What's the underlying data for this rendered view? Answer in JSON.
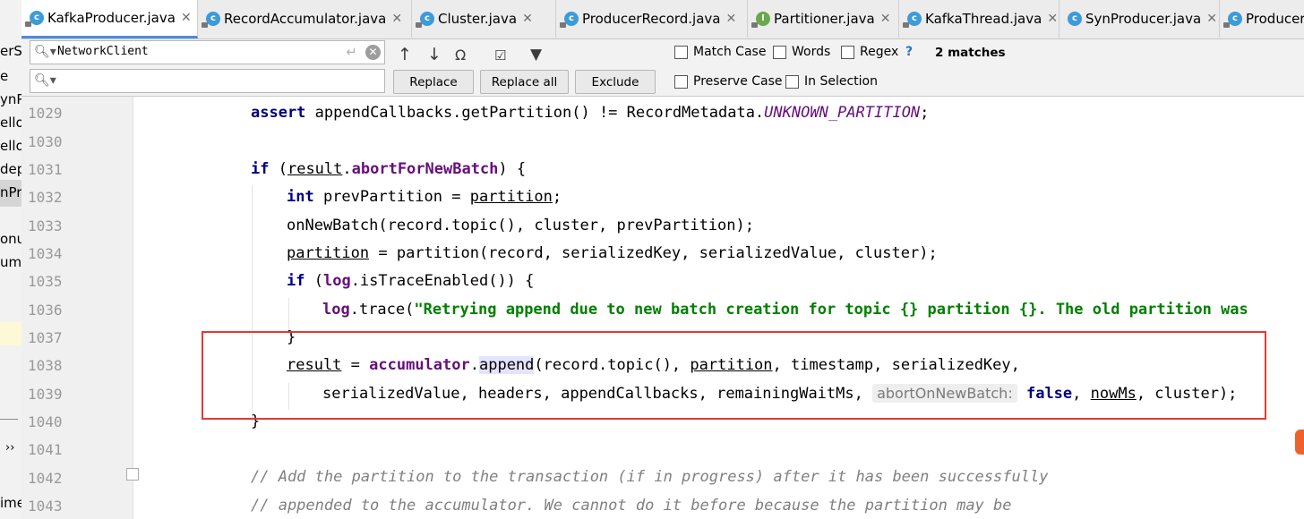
{
  "left_panel": {
    "fragments": [
      "erS",
      "e",
      "ynP",
      "ello",
      "ello",
      "dep",
      "nPr",
      "onus",
      "ume",
      "ime",
      "››"
    ]
  },
  "tabs": [
    {
      "label": "KafkaProducer.java",
      "icon": "class-icon",
      "active": true
    },
    {
      "label": "RecordAccumulator.java",
      "icon": "class-icon"
    },
    {
      "label": "Cluster.java",
      "icon": "class-icon"
    },
    {
      "label": "ProducerRecord.java",
      "icon": "class-icon"
    },
    {
      "label": "Partitioner.java",
      "icon": "interface-icon"
    },
    {
      "label": "KafkaThread.java",
      "icon": "class-icon"
    },
    {
      "label": "SynProducer.java",
      "icon": "class-icon"
    },
    {
      "label": "ProducerC",
      "icon": "class-icon"
    }
  ],
  "find": {
    "search_value": "NetworkClient",
    "replace_value": "",
    "buttons": {
      "replace": "Replace",
      "replace_all": "Replace all",
      "exclude": "Exclude"
    },
    "options": {
      "match_case": "Match Case",
      "words": "Words",
      "regex": "Regex",
      "preserve_case": "Preserve Case",
      "in_selection": "In Selection"
    },
    "help": "?",
    "matches": "2 matches"
  },
  "editor": {
    "line_numbers": [
      "1029",
      "1030",
      "1031",
      "1032",
      "1033",
      "1034",
      "1035",
      "1036",
      "1037",
      "1038",
      "1039",
      "1040",
      "1041",
      "1042",
      "1043"
    ],
    "hint_label": "abortOnNewBatch:",
    "log_string": "\"Retrying append due to new batch creation for topic {} partition {}. The old partition was",
    "comment_1": "// Add the partition to the transaction (if in progress) after it has been successfully",
    "comment_2": "// appended to the accumulator. We cannot do it before because the partition may be"
  },
  "colors": {
    "highlight_box": "#e53935",
    "active_tab_underline": "#4b8ddc",
    "keyword": "#000080",
    "field": "#660e7a",
    "string": "#008000"
  }
}
